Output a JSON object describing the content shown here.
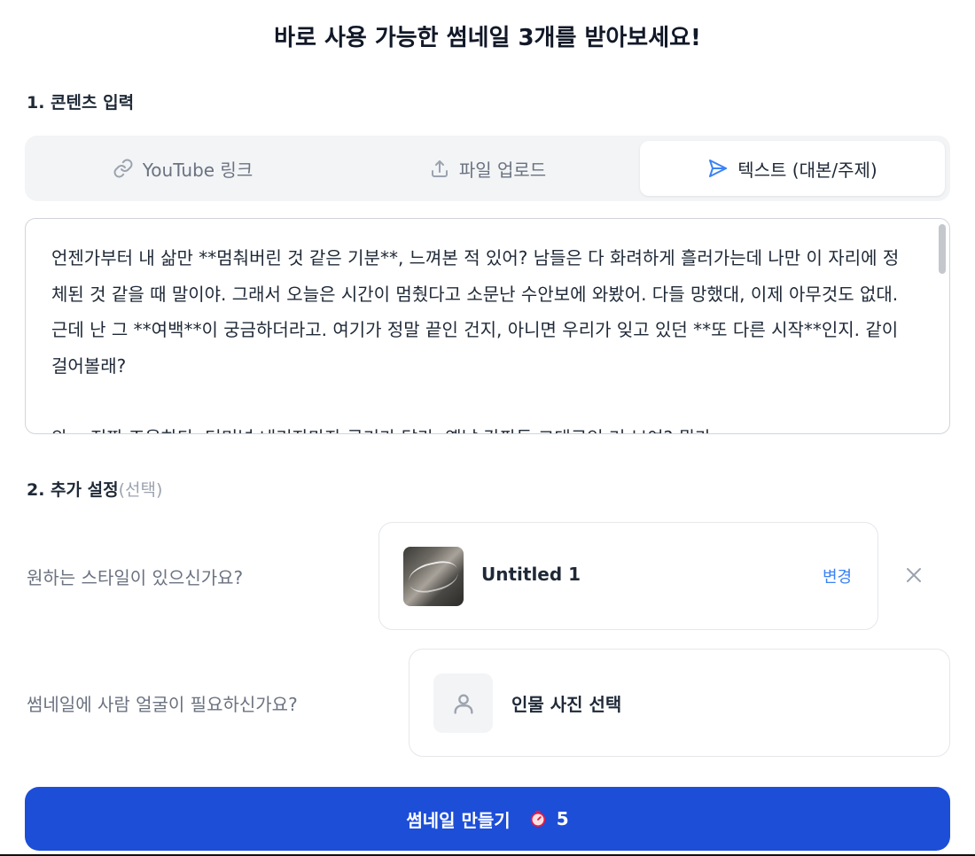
{
  "page_title": "바로 사용 가능한 썸네일 3개를 받아보세요!",
  "section1": {
    "label": "1. 콘텐츠 입력"
  },
  "tabs": [
    {
      "label": "YouTube 링크",
      "icon": "link-icon",
      "active": false
    },
    {
      "label": "파일 업로드",
      "icon": "upload-icon",
      "active": false
    },
    {
      "label": "텍스트 (대본/주제)",
      "icon": "send-icon",
      "active": true
    }
  ],
  "content_text": "언젠가부터 내 삶만 **멈춰버린 것 같은 기분**, 느껴본 적 있어? 남들은 다 화려하게 흘러가는데 나만 이 자리에 정체된 것 같을 때 말이야. 그래서 오늘은 시간이 멈췄다고 소문난 수안보에 와봤어. 다들 망했대, 이제 아무것도 없대. 근데 난 그 **여백**이 궁금하더라고. 여기가 정말 끝인 건지, 아니면 우리가 잊고 있던 **또 다른 시작**인지. 같이 걸어볼래?\n\n와... 진짜 조용하다. 터미널 내리자마자 공기가 달라. 옛날 간판들 그대로인 거 보여? 뭔가",
  "section2": {
    "label": "2. 추가 설정",
    "optional": "(선택)"
  },
  "style_question": "원하는 스타일이 있으신가요?",
  "style_card": {
    "name": "Untitled 1",
    "change_label": "변경",
    "thumb_icon": "style-thumbnail-image",
    "close_icon": "close-icon"
  },
  "face_question": "썸네일에 사람 얼굴이 필요하신가요?",
  "person_card": {
    "label": "인물 사진 선택",
    "icon": "person-icon"
  },
  "make_button": {
    "label": "썸네일 만들기",
    "credit_icon": "timer-icon",
    "credit_count": "5"
  },
  "colors": {
    "primary": "#1d4ed8",
    "link": "#3b82f6",
    "tab_bg": "#f2f4f6"
  }
}
